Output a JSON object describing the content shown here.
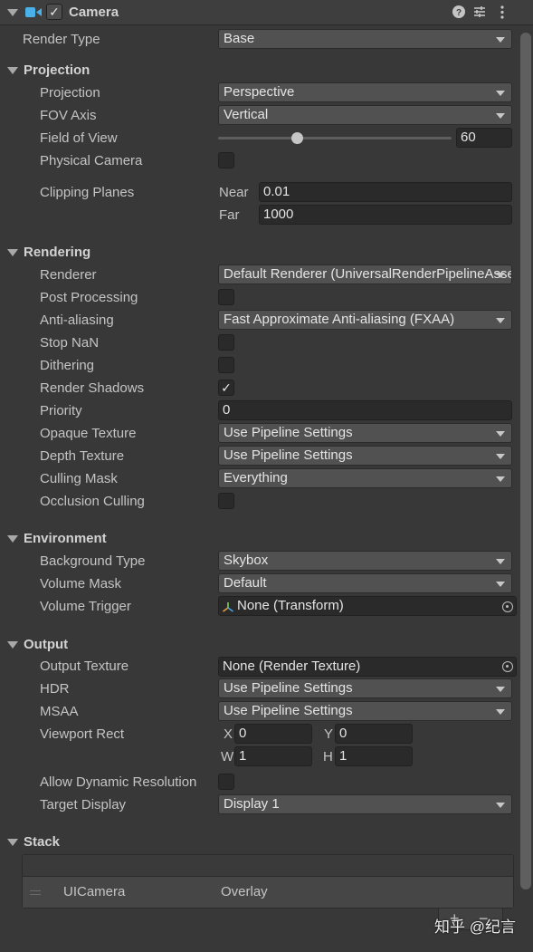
{
  "header": {
    "title": "Camera",
    "enabled": true
  },
  "render_type": {
    "label": "Render Type",
    "value": "Base"
  },
  "projection_section": {
    "title": "Projection",
    "projection": {
      "label": "Projection",
      "value": "Perspective"
    },
    "fov_axis": {
      "label": "FOV Axis",
      "value": "Vertical"
    },
    "field_of_view": {
      "label": "Field of View",
      "value": "60"
    },
    "physical_camera": {
      "label": "Physical Camera",
      "checked": false
    },
    "clipping_planes": {
      "label": "Clipping Planes",
      "near_label": "Near",
      "near": "0.01",
      "far_label": "Far",
      "far": "1000"
    }
  },
  "rendering_section": {
    "title": "Rendering",
    "renderer": {
      "label": "Renderer",
      "value": "Default Renderer (UniversalRenderPipelineAsset_Renderer)"
    },
    "post_processing": {
      "label": "Post Processing",
      "checked": false
    },
    "anti_aliasing": {
      "label": "Anti-aliasing",
      "value": "Fast Approximate Anti-aliasing (FXAA)"
    },
    "stop_nan": {
      "label": "Stop NaN",
      "checked": false
    },
    "dithering": {
      "label": "Dithering",
      "checked": false
    },
    "render_shadows": {
      "label": "Render Shadows",
      "checked": true,
      "mark": "✓"
    },
    "priority": {
      "label": "Priority",
      "value": "0"
    },
    "opaque_texture": {
      "label": "Opaque Texture",
      "value": "Use Pipeline Settings"
    },
    "depth_texture": {
      "label": "Depth Texture",
      "value": "Use Pipeline Settings"
    },
    "culling_mask": {
      "label": "Culling Mask",
      "value": "Everything"
    },
    "occlusion_culling": {
      "label": "Occlusion Culling",
      "checked": false
    }
  },
  "environment_section": {
    "title": "Environment",
    "background_type": {
      "label": "Background Type",
      "value": "Skybox"
    },
    "volume_mask": {
      "label": "Volume Mask",
      "value": "Default"
    },
    "volume_trigger": {
      "label": "Volume Trigger",
      "value": "None (Transform)"
    }
  },
  "output_section": {
    "title": "Output",
    "output_texture": {
      "label": "Output Texture",
      "value": "None (Render Texture)"
    },
    "hdr": {
      "label": "HDR",
      "value": "Use Pipeline Settings"
    },
    "msaa": {
      "label": "MSAA",
      "value": "Use Pipeline Settings"
    },
    "viewport_rect": {
      "label": "Viewport Rect",
      "x_label": "X",
      "x": "0",
      "y_label": "Y",
      "y": "0",
      "w_label": "W",
      "w": "1",
      "h_label": "H",
      "h": "1"
    },
    "allow_dynamic_resolution": {
      "label": "Allow Dynamic Resolution",
      "checked": false
    },
    "target_display": {
      "label": "Target Display",
      "value": "Display 1"
    }
  },
  "stack_section": {
    "title": "Stack",
    "items": [
      {
        "name": "UICamera",
        "type": "Overlay"
      }
    ],
    "add_symbol": "+",
    "remove_symbol": "−"
  },
  "watermark": "知乎 @纪言",
  "icons": {
    "camera": "camera-icon",
    "help": "help-icon",
    "presets": "presets-icon",
    "menu": "kebab-menu-icon",
    "foldout": "foldout-arrow-icon",
    "dropdown": "dropdown-arrow-icon",
    "object_picker": "object-picker-icon",
    "transform": "transform-icon"
  },
  "colors": {
    "background": "#383838",
    "field": "#2a2a2a",
    "dropdown": "#515151",
    "camera_icon": "#4ab0e8"
  }
}
